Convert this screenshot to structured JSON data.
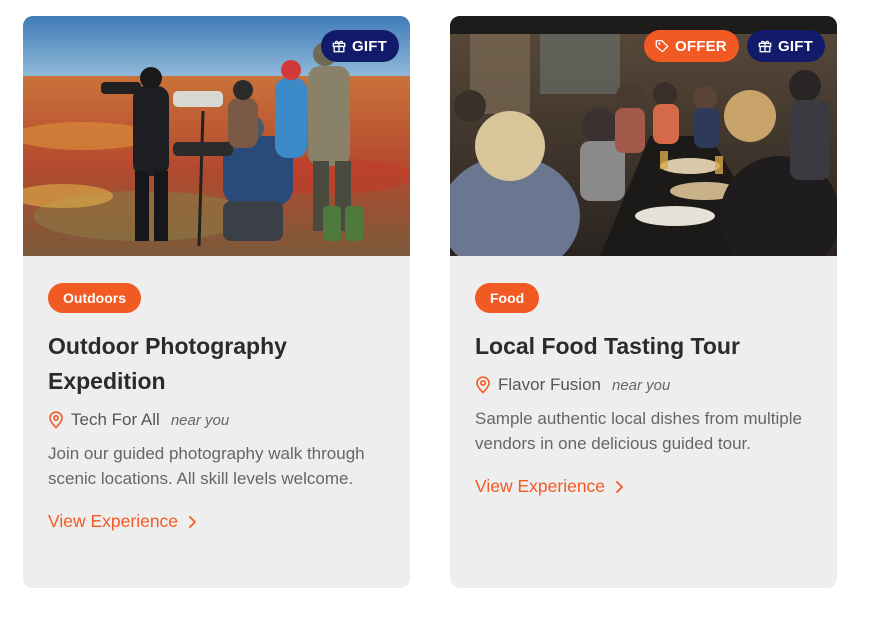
{
  "cards": [
    {
      "category": "Outdoors",
      "title": "Outdoor Photography Expedition",
      "location": "Tech For All",
      "proximity": "near you",
      "description": "Join our guided photography walk through scenic locations. All skill levels welcome.",
      "cta": "View Experience",
      "badges": {
        "gift": "GIFT"
      },
      "image_alt": "Photographers with cameras on tripods in a colorful autumn tundra field"
    },
    {
      "category": "Food",
      "title": "Local Food Tasting Tour",
      "location": "Flavor Fusion",
      "proximity": "near you",
      "description": "Sample authentic local dishes from multiple vendors in one delicious guided tour.",
      "cta": "View Experience",
      "badges": {
        "offer": "OFFER",
        "gift": "GIFT"
      },
      "image_alt": "People sharing food at a long table at an outdoor dinner"
    }
  ],
  "colors": {
    "accent": "#f25a24",
    "gift_badge": "#121a6a",
    "card_bg": "#eeeeee",
    "title_text": "#2b2b2b",
    "body_text": "#666666"
  },
  "icons": {
    "gift": "gift-icon",
    "offer": "tag-icon",
    "location": "map-pin-icon",
    "cta": "chevron-right-icon"
  }
}
